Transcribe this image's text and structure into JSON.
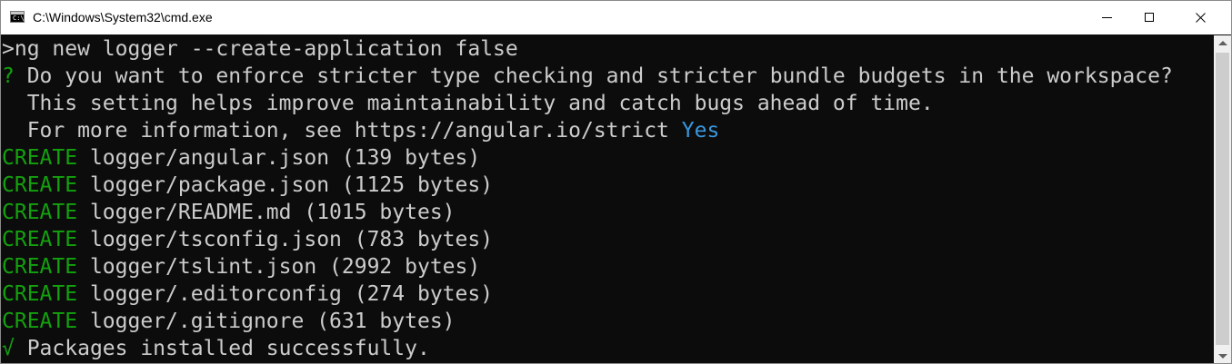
{
  "window": {
    "title": "C:\\Windows\\System32\\cmd.exe",
    "icon": "cmd-console-icon",
    "icon_text": "C:\\."
  },
  "caption_buttons": {
    "minimize_icon": "minimize-icon",
    "maximize_icon": "maximize-icon",
    "close_icon": "close-icon"
  },
  "console": {
    "colors": {
      "background": "#0c0c0c",
      "text": "#cccccc",
      "green": "#13a10e",
      "blue": "#3a96dd"
    },
    "command": ">ng new logger --create-application false",
    "prompt": {
      "mark": "?",
      "question": " Do you want to enforce stricter type checking and stricter bundle budgets in the workspace?",
      "line2": "  This setting helps improve maintainability and catch bugs ahead of time.",
      "line3": "  For more information, see https://angular.io/strict ",
      "answer": "Yes"
    },
    "create_lines": [
      {
        "action": "CREATE",
        "text": " logger/angular.json (139 bytes)"
      },
      {
        "action": "CREATE",
        "text": " logger/package.json (1125 bytes)"
      },
      {
        "action": "CREATE",
        "text": " logger/README.md (1015 bytes)"
      },
      {
        "action": "CREATE",
        "text": " logger/tsconfig.json (783 bytes)"
      },
      {
        "action": "CREATE",
        "text": " logger/tslint.json (2992 bytes)"
      },
      {
        "action": "CREATE",
        "text": " logger/.editorconfig (274 bytes)"
      },
      {
        "action": "CREATE",
        "text": " logger/.gitignore (631 bytes)"
      }
    ],
    "success": {
      "mark": "√",
      "text": " Packages installed successfully."
    }
  },
  "scrollbar": {
    "up_icon": "scroll-up-arrow-icon",
    "down_icon": "scroll-down-arrow-icon"
  }
}
